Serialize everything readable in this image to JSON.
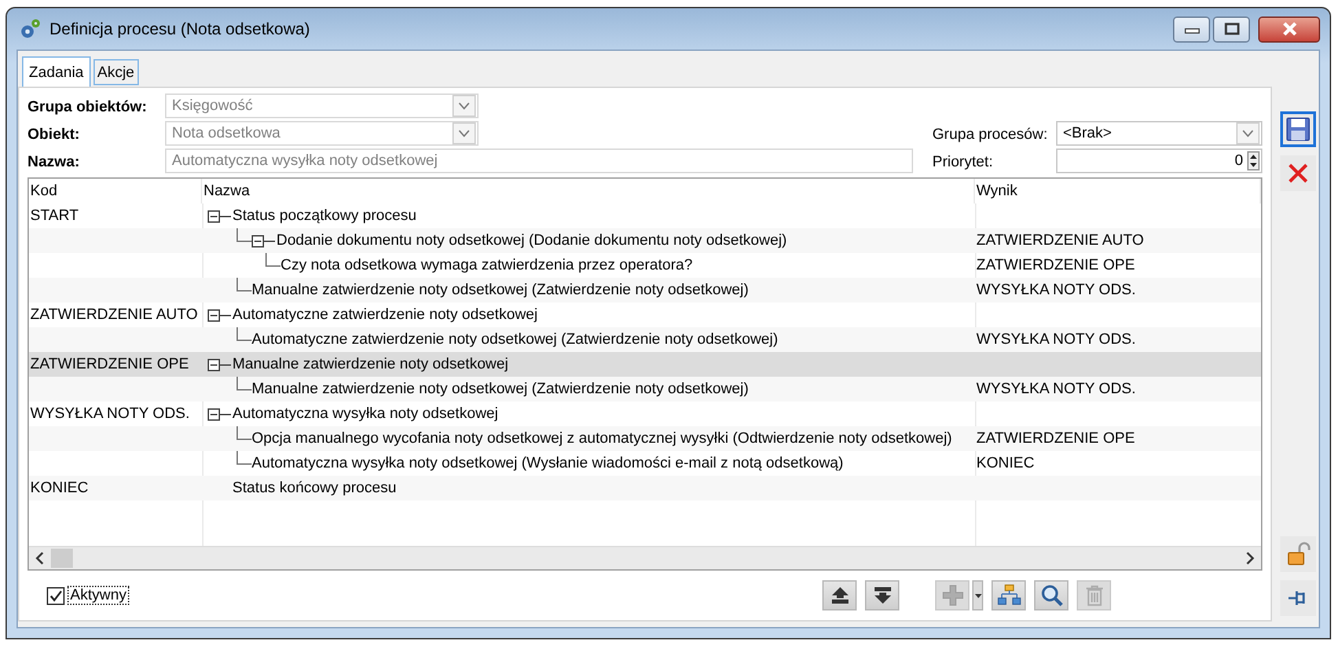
{
  "window": {
    "title": "Definicja procesu (Nota odsetkowa)"
  },
  "tabs": [
    {
      "label": "Zadania",
      "selected": true
    },
    {
      "label": "Akcje",
      "selected": false
    }
  ],
  "form": {
    "object_group": {
      "label": "Grupa obiektów:",
      "value": "Księgowość",
      "disabled": true
    },
    "object": {
      "label": "Obiekt:",
      "value": "Nota odsetkowa",
      "disabled": true
    },
    "name": {
      "label": "Nazwa:",
      "value": "Automatyczna wysyłka noty odsetkowej",
      "disabled": true
    },
    "process_group": {
      "label": "Grupa procesów:",
      "value": "<Brak>",
      "disabled": false
    },
    "priority": {
      "label": "Priorytet:",
      "value": "0"
    }
  },
  "tree": {
    "columns": [
      "Kod",
      "Nazwa",
      "Wynik"
    ],
    "rows": [
      {
        "code": "START",
        "name": "Status początkowy procesu",
        "selected": false,
        "expanded": true,
        "children": [
          {
            "name": "Dodanie dokumentu noty odsetkowej (Dodanie dokumentu noty odsetkowej)",
            "result": "ZATWIERDZENIE AUTO",
            "selected": false,
            "expanded": true,
            "children": [
              {
                "name": "Czy nota odsetkowa wymaga zatwierdzenia przez operatora?",
                "result": "ZATWIERDZENIE OPE",
                "selected": false
              }
            ]
          },
          {
            "name": "Manualne zatwierdzenie noty odsetkowej (Zatwierdzenie noty odsetkowej)",
            "result": "WYSYŁKA NOTY ODS.",
            "selected": false
          }
        ]
      },
      {
        "code": "ZATWIERDZENIE AUTO",
        "name": "Automatyczne zatwierdzenie noty odsetkowej",
        "selected": false,
        "expanded": true,
        "children": [
          {
            "name": "Automatyczne zatwierdzenie noty odsetkowej (Zatwierdzenie noty odsetkowej)",
            "result": "WYSYŁKA NOTY ODS.",
            "selected": false
          }
        ]
      },
      {
        "code": "ZATWIERDZENIE OPE",
        "name": "Manualne zatwierdzenie noty odsetkowej",
        "selected": true,
        "expanded": true,
        "children": [
          {
            "name": "Manualne zatwierdzenie noty odsetkowej (Zatwierdzenie noty odsetkowej)",
            "result": "WYSYŁKA NOTY ODS.",
            "selected": false
          }
        ]
      },
      {
        "code": "WYSYŁKA NOTY ODS.",
        "name": "Automatyczna wysyłka noty odsetkowej",
        "selected": false,
        "expanded": true,
        "children": [
          {
            "name": "Opcja manualnego wycofania noty odsetkowej z automatycznej wysyłki (Odtwierdzenie noty odsetkowej)",
            "result": "ZATWIERDZENIE OPE",
            "selected": false
          },
          {
            "name": "Automatyczna wysyłka noty odsetkowej (Wysłanie wiadomości e-mail z notą odsetkową)",
            "result": "KONIEC",
            "selected": false
          }
        ]
      },
      {
        "code": "KONIEC",
        "name": "Status końcowy procesu",
        "selected": false
      }
    ]
  },
  "active": {
    "label": "Aktywny",
    "checked": true
  },
  "toolbar": [
    {
      "kind": "up",
      "disabled": false
    },
    {
      "kind": "down",
      "disabled": false
    },
    {
      "kind": "add",
      "disabled": true
    },
    {
      "kind": "hierarchy",
      "disabled": false
    },
    {
      "kind": "search",
      "disabled": false
    },
    {
      "kind": "delete",
      "disabled": true
    }
  ],
  "side_buttons": [
    {
      "kind": "save",
      "focused": true
    },
    {
      "kind": "cancel",
      "focused": false
    },
    {
      "kind": "lock",
      "focused": false
    },
    {
      "kind": "pin",
      "focused": false
    }
  ]
}
